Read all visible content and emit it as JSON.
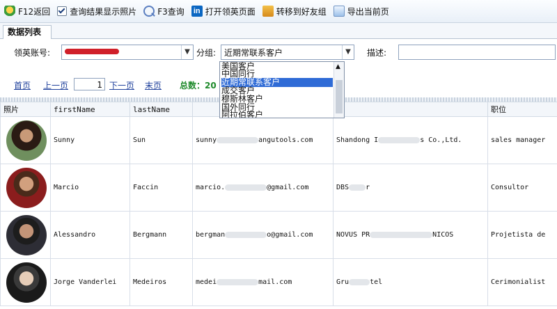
{
  "toolbar": {
    "back": "F12返回",
    "show_photos": "查询结果显示照片",
    "f3_search": "F3查询",
    "open_linkedin": "打开领英页面",
    "move_to_friends": "转移到好友组",
    "export_page": "导出当前页"
  },
  "tabs": [
    "数据列表"
  ],
  "filters": {
    "account_label": "领英账号:",
    "group_label": "分组:",
    "group_value": "近期常联系客户",
    "desc_label": "描述:",
    "group_options": [
      "美国客户",
      "中国同行",
      "近期常联系客户",
      "成交客户",
      "穆斯林客户",
      "国外同行",
      "阿拉伯客户"
    ]
  },
  "pager": {
    "first": "首页",
    "prev": "上一页",
    "page": "1",
    "next": "下一页",
    "last": "末页",
    "total": "总数：20"
  },
  "table": {
    "headers": [
      "照片",
      "firstName",
      "lastName",
      "",
      "",
      "职位"
    ],
    "rows": [
      {
        "first": "Sunny",
        "last": "Sun",
        "email_a": "sunny",
        "email_b": "angutools.com",
        "company_a": "Shandong I",
        "company_b": "s Co.,Ltd.",
        "title": "sales manager"
      },
      {
        "first": "Marcio",
        "last": "Faccin",
        "email_a": "marcio.",
        "email_b": "@gmail.com",
        "company_a": "DBS",
        "company_b": "r",
        "title": "Consultor"
      },
      {
        "first": "Alessandro",
        "last": "Bergmann",
        "email_a": "bergman",
        "email_b": "o@gmail.com",
        "company_a": "NOVUS PR",
        "company_b": "NICOS",
        "title": "Projetista de"
      },
      {
        "first": "Jorge Vanderlei",
        "last": "Medeiros",
        "email_a": "medei",
        "email_b": "mail.com",
        "company_a": "Gru",
        "company_b": "tel",
        "title": "Cerimonialist"
      }
    ]
  },
  "colors": {
    "link": "#1d3f9b",
    "total": "#1e8a2b",
    "selection": "#2f6bd6",
    "redaction": "#d0202a"
  }
}
